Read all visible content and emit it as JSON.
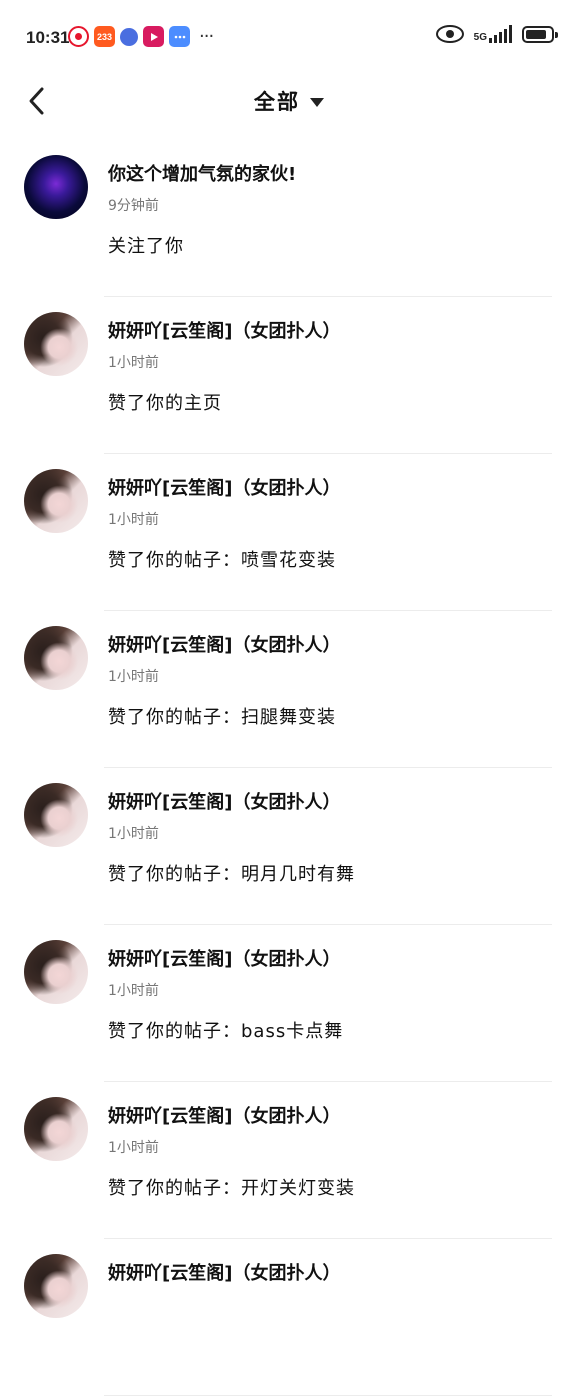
{
  "status_bar": {
    "time": "10:31",
    "app_icons": [
      "weibo-icon",
      "233-icon",
      "circle-app-icon",
      "play-app-icon",
      "message-app-icon"
    ],
    "badge_233": "233",
    "more": "···",
    "network": "5G",
    "battery_level": 0.85
  },
  "header": {
    "title": "全部",
    "back_icon": "chevron-left-icon",
    "dropdown_icon": "caret-down-icon"
  },
  "notifications": [
    {
      "avatar": "dark",
      "name": "你这个增加气氛的家伙!",
      "time": "9分钟前",
      "action": "关注了你"
    },
    {
      "avatar": "girl",
      "name": "妍妍吖[云笙阁]（女团扑人）",
      "time": "1小时前",
      "action": "赞了你的主页"
    },
    {
      "avatar": "girl",
      "name": "妍妍吖[云笙阁]（女团扑人）",
      "time": "1小时前",
      "action": "赞了你的帖子：喷雪花变装"
    },
    {
      "avatar": "girl",
      "name": "妍妍吖[云笙阁]（女团扑人）",
      "time": "1小时前",
      "action": "赞了你的帖子：扫腿舞变装"
    },
    {
      "avatar": "girl",
      "name": "妍妍吖[云笙阁]（女团扑人）",
      "time": "1小时前",
      "action": "赞了你的帖子：明月几时有舞"
    },
    {
      "avatar": "girl",
      "name": "妍妍吖[云笙阁]（女团扑人）",
      "time": "1小时前",
      "action": "赞了你的帖子：bass卡点舞"
    },
    {
      "avatar": "girl",
      "name": "妍妍吖[云笙阁]（女团扑人）",
      "time": "1小时前",
      "action": "赞了你的帖子：开灯关灯变装"
    },
    {
      "avatar": "girl",
      "name": "妍妍吖[云笙阁]（女团扑人）",
      "time": "",
      "action": ""
    }
  ]
}
